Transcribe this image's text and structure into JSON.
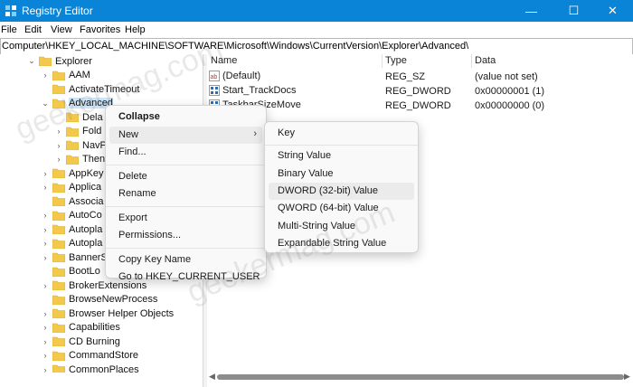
{
  "window": {
    "title": "Registry Editor",
    "minimize_glyph": "—",
    "maximize_glyph": "☐",
    "close_glyph": "✕"
  },
  "menubar": [
    "File",
    "Edit",
    "View",
    "Favorites",
    "Help"
  ],
  "address": "Computer\\HKEY_LOCAL_MACHINE\\SOFTWARE\\Microsoft\\Windows\\CurrentVersion\\Explorer\\Advanced\\",
  "tree": [
    {
      "label": "Explorer",
      "chevron": "v"
    },
    {
      "label": "AAM",
      "chevron": ">"
    },
    {
      "label": "ActivateTimeout",
      "chevron": ""
    },
    {
      "label": "Advanced",
      "chevron": "v",
      "selected": true
    },
    {
      "label": "Dela",
      "chevron": ""
    },
    {
      "label": "Fold",
      "chevron": ">"
    },
    {
      "label": "NavP",
      "chevron": ">"
    },
    {
      "label": "Then",
      "chevron": ">"
    },
    {
      "label": "AppKey",
      "chevron": ">"
    },
    {
      "label": "Applica",
      "chevron": ">"
    },
    {
      "label": "Associa",
      "chevron": ""
    },
    {
      "label": "AutoCo",
      "chevron": ">"
    },
    {
      "label": "Autopla",
      "chevron": ">"
    },
    {
      "label": "Autopla",
      "chevron": ">"
    },
    {
      "label": "BannerS",
      "chevron": ">"
    },
    {
      "label": "BootLo",
      "chevron": ""
    },
    {
      "label": "BrokerExtensions",
      "chevron": ">"
    },
    {
      "label": "BrowseNewProcess",
      "chevron": ""
    },
    {
      "label": "Browser Helper Objects",
      "chevron": ">"
    },
    {
      "label": "Capabilities",
      "chevron": ">"
    },
    {
      "label": "CD Burning",
      "chevron": ">"
    },
    {
      "label": "CommandStore",
      "chevron": ">"
    },
    {
      "label": "CommonPlaces",
      "chevron": ">"
    }
  ],
  "values_header": {
    "name": "Name",
    "type": "Type",
    "data": "Data"
  },
  "values": [
    {
      "name": "(Default)",
      "icon": "string-value-icon",
      "type": "REG_SZ",
      "data": "(value not set)"
    },
    {
      "name": "Start_TrackDocs",
      "icon": "binary-value-icon",
      "type": "REG_DWORD",
      "data": "0x00000001 (1)"
    },
    {
      "name": "TaskbarSizeMove",
      "icon": "binary-value-icon",
      "type": "REG_DWORD",
      "data": "0x00000000 (0)"
    }
  ],
  "context_menu": {
    "items": [
      {
        "label": "Collapse",
        "bold": true
      },
      {
        "label": "New",
        "submenu": true,
        "hover": true
      },
      {
        "label": "Find..."
      },
      {
        "sep": true
      },
      {
        "label": "Delete"
      },
      {
        "label": "Rename"
      },
      {
        "sep": true
      },
      {
        "label": "Export"
      },
      {
        "label": "Permissions..."
      },
      {
        "sep": true
      },
      {
        "label": "Copy Key Name"
      },
      {
        "label": "Go to HKEY_CURRENT_USER"
      }
    ]
  },
  "submenu": {
    "items": [
      {
        "label": "Key"
      },
      {
        "sep": true
      },
      {
        "label": "String Value"
      },
      {
        "label": "Binary Value"
      },
      {
        "label": "DWORD (32-bit) Value",
        "hover": true
      },
      {
        "label": "QWORD (64-bit) Value"
      },
      {
        "label": "Multi-String Value"
      },
      {
        "label": "Expandable String Value"
      }
    ]
  },
  "watermark": {
    "text": "geekermag.com"
  },
  "colors": {
    "titlebar": "#0a84d6",
    "folder": "#f2c94c",
    "selection": "#cce4f7"
  }
}
